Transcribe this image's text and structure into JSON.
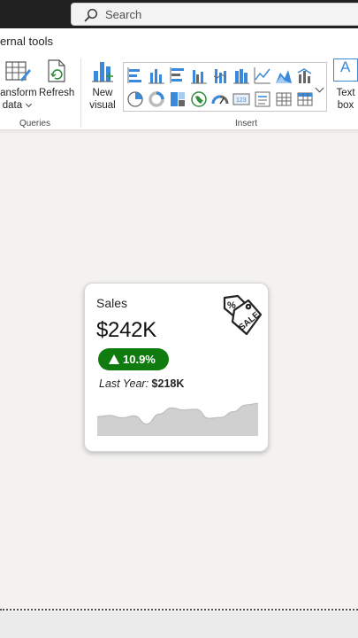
{
  "titlebar": {
    "search_placeholder": "Search"
  },
  "ribbon": {
    "tab_partial_label": "ernal tools",
    "queries_group": {
      "label": "Queries",
      "transform_label_line1": "ransform",
      "transform_label_line2": "data",
      "refresh_label": "Refresh"
    },
    "insert_group": {
      "label": "Insert",
      "new_visual_line1": "New",
      "new_visual_line2": "visual",
      "text_box_line1": "Text",
      "text_box_line2": "box",
      "text_box_glyph": "A",
      "gallery_icons": [
        "stacked-bar-chart-icon",
        "stacked-column-chart-icon",
        "clustered-bar-chart-icon",
        "clustered-column-chart-icon",
        "stacked-bar-100-icon",
        "stacked-column-100-icon",
        "line-chart-icon",
        "area-chart-icon",
        "line-column-chart-icon",
        "pie-chart-icon",
        "donut-chart-icon",
        "treemap-icon",
        "map-icon",
        "gauge-icon",
        "card-icon",
        "multi-row-card-icon",
        "table-icon",
        "matrix-icon"
      ]
    }
  },
  "card": {
    "title": "Sales",
    "value": "$242K",
    "change": "10.9%",
    "last_year_label": "Last Year:",
    "last_year_value": "$218K",
    "icon": "sale-tag-icon",
    "badge_color": "#107c10",
    "sparkline_color": "#d0d0d0"
  },
  "sparkline": [
    0.35,
    0.4,
    0.3,
    0.38,
    0.05,
    0.45,
    0.7,
    0.62,
    0.65,
    0.28,
    0.32,
    0.55,
    0.82,
    0.88
  ]
}
